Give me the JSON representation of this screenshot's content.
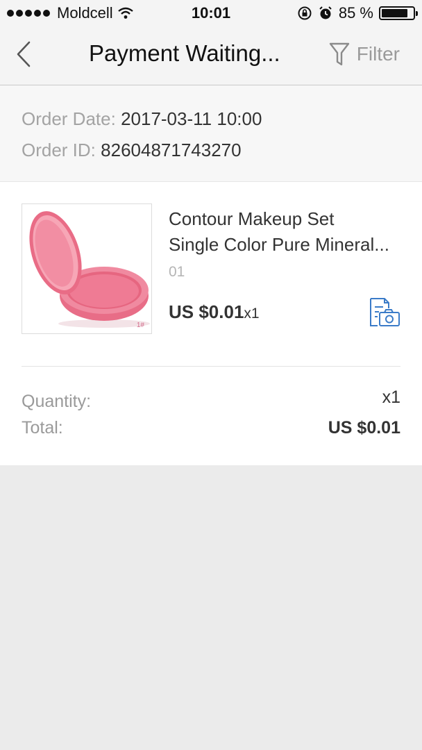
{
  "status_bar": {
    "carrier": "Moldcell",
    "time": "10:01",
    "battery_text": "85 %",
    "battery_level": 0.85
  },
  "nav": {
    "title": "Payment Waiting...",
    "filter_label": "Filter"
  },
  "order": {
    "date_label": "Order Date:",
    "date_value": "2017-03-11 10:00",
    "id_label": "Order ID:",
    "id_value": "82604871743270"
  },
  "product": {
    "title_line1": "Contour Makeup Set",
    "title_line2": "Single Color Pure Mineral...",
    "sku": "01",
    "price": "US $0.01",
    "qty": "x1",
    "image_tag": "1#"
  },
  "summary": {
    "quantity_label": "Quantity:",
    "quantity_value": "x1",
    "total_label": "Total:",
    "total_value": "US $0.01"
  },
  "colors": {
    "accent_blue": "#3a7bc8",
    "compact_pink": "#ee7f96"
  }
}
